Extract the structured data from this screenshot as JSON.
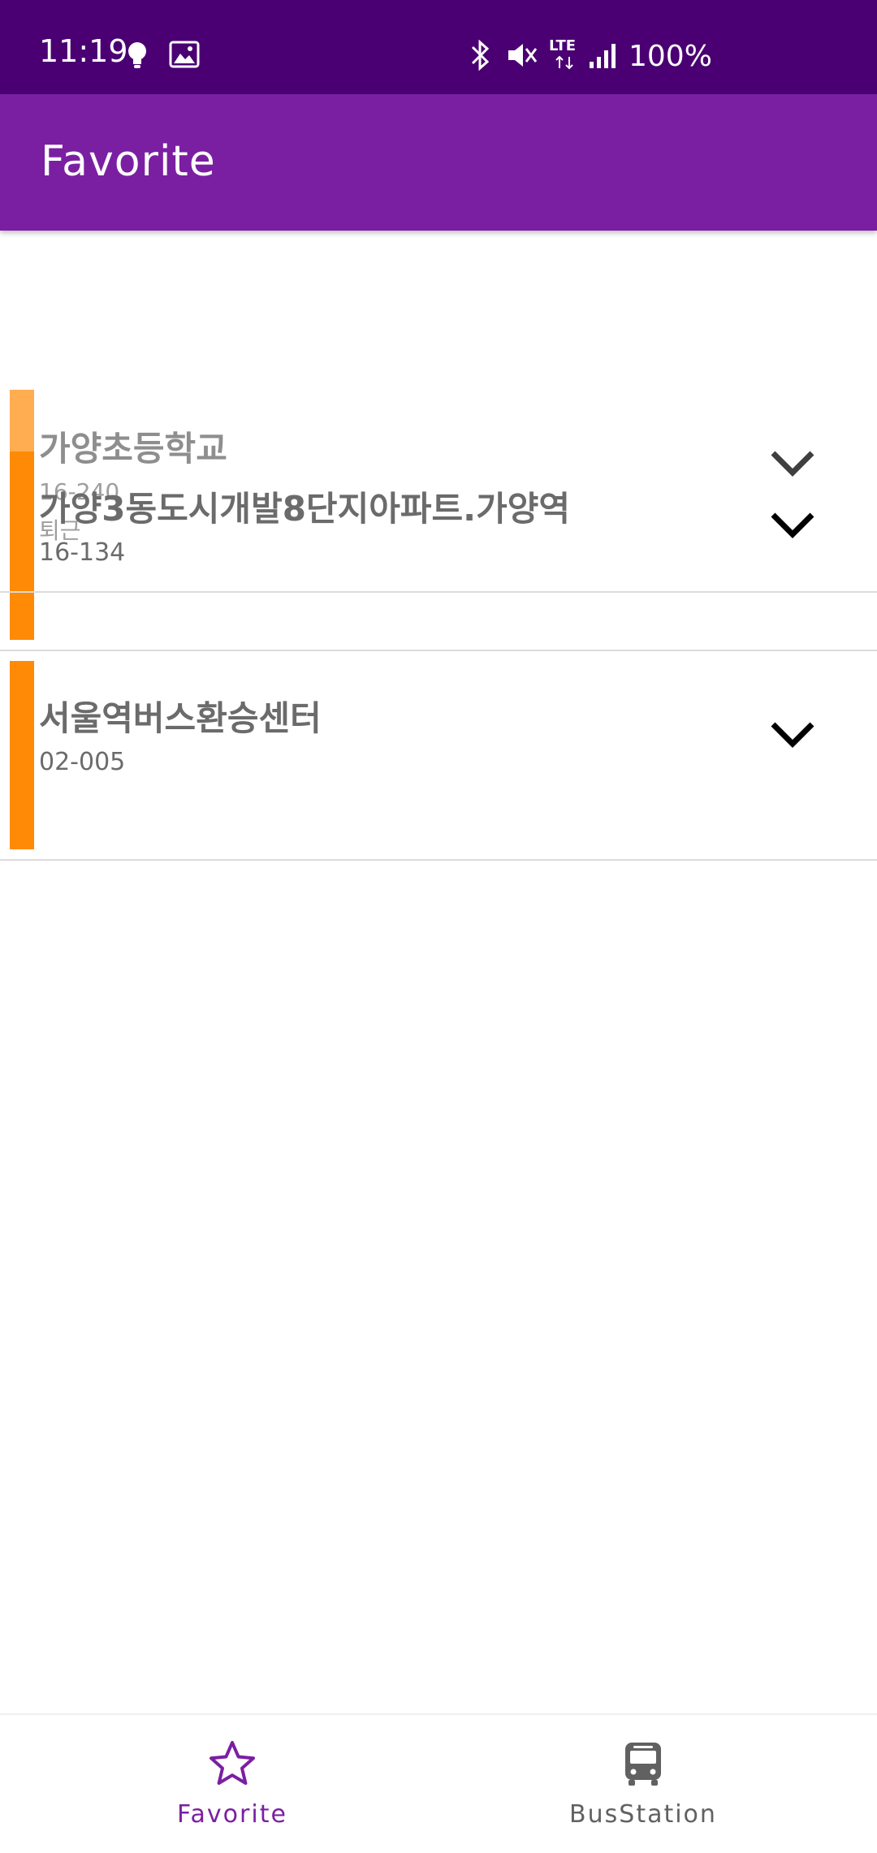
{
  "status_bar": {
    "time": "11:19",
    "battery": "100%",
    "icons": [
      "bulb-icon",
      "image-icon",
      "bluetooth-icon",
      "mute-icon",
      "lte-icon",
      "signal-icon"
    ],
    "lte_label": "LTE",
    "background": "#4a0072"
  },
  "app_bar": {
    "title": "Favorite",
    "background": "#7b1fa2"
  },
  "favorites": [
    {
      "name": "가양초등학교",
      "code": "16-240",
      "memo": "퇴근",
      "state": "dragging-ghost"
    },
    {
      "name": "가양3동도시개발8단지아파트.가양역",
      "code": "16-134"
    },
    {
      "name": "서울역버스환승센터",
      "code": "02-005"
    }
  ],
  "accent_color": "#ff8a05",
  "bottom_nav": {
    "items": [
      {
        "label": "Favorite",
        "icon": "star-icon",
        "selected": true,
        "color": "#7b1fa2"
      },
      {
        "label": "BusStation",
        "icon": "bus-icon",
        "selected": false,
        "color": "#616161"
      }
    ]
  }
}
